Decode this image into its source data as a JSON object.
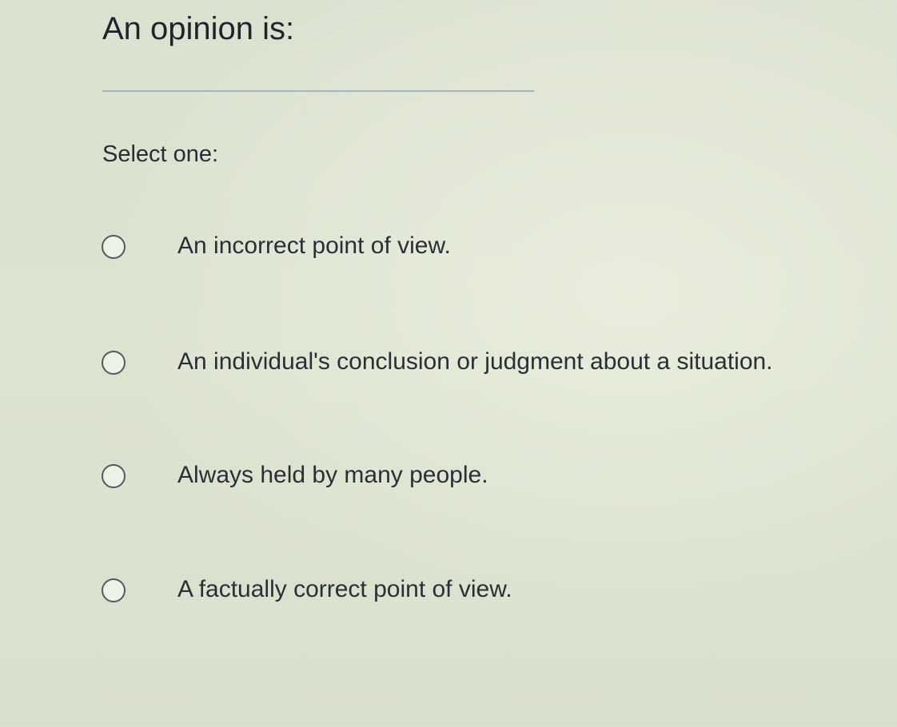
{
  "question": {
    "title": "An opinion is:",
    "prompt": "Select one:"
  },
  "options": [
    {
      "label": "An incorrect point of view.",
      "selected": false
    },
    {
      "label": "An individual's conclusion or judgment about a situation.",
      "selected": false
    },
    {
      "label": "Always held by many people.",
      "selected": false
    },
    {
      "label": "A factually correct point of view.",
      "selected": false
    }
  ]
}
